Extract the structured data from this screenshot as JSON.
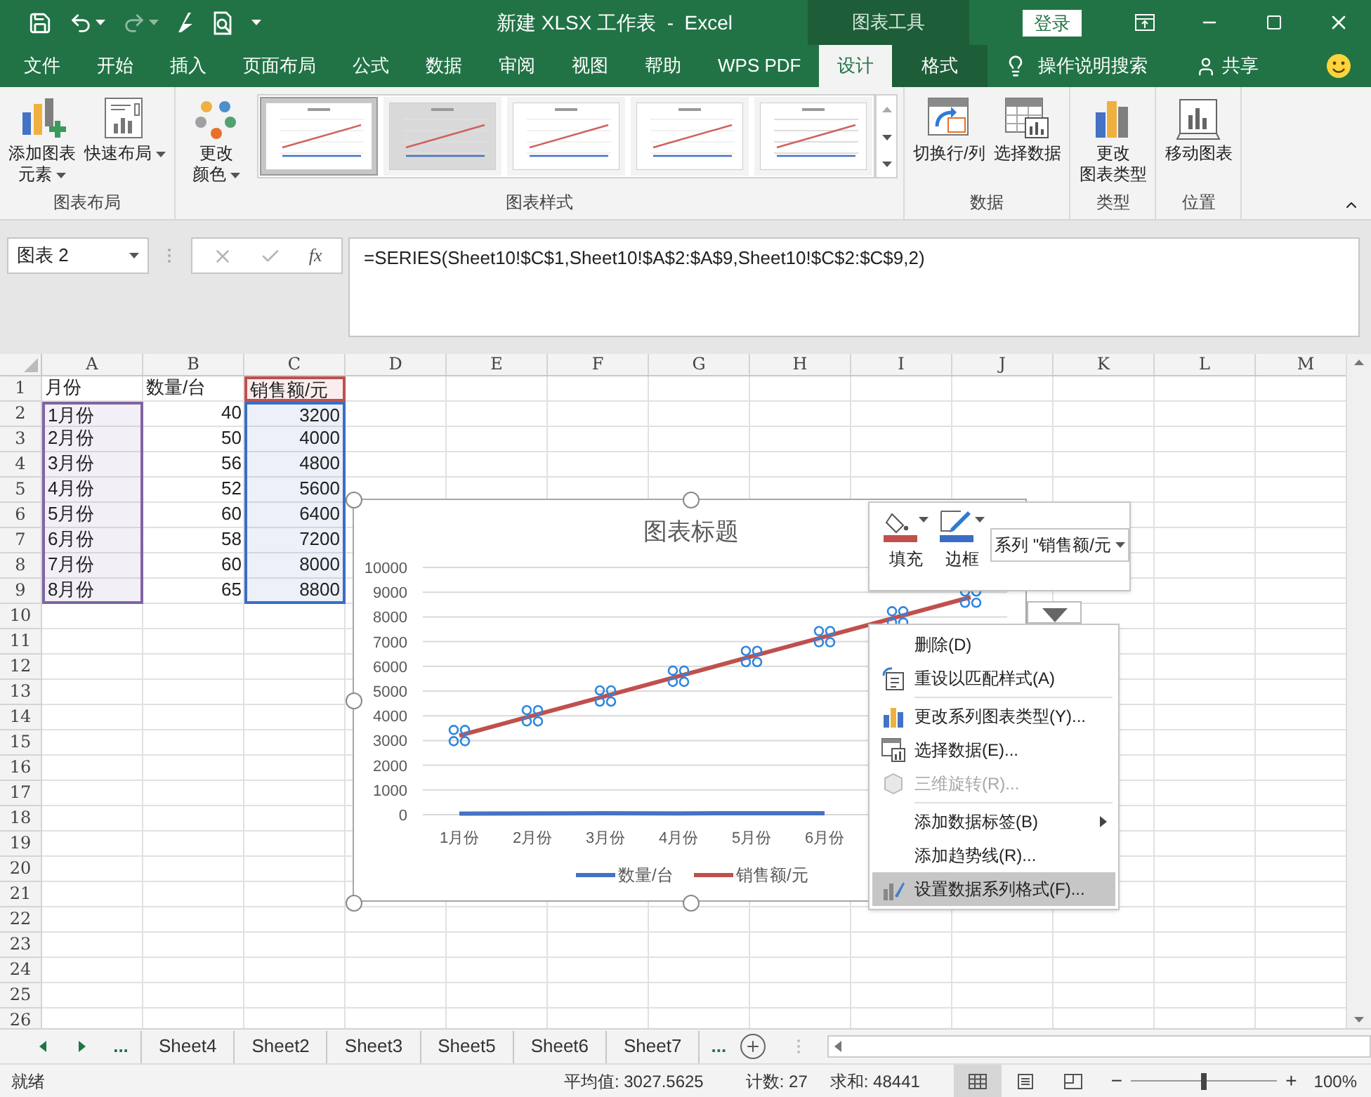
{
  "window": {
    "title": "新建 XLSX 工作表  -  Excel",
    "context_tab_group": "图表工具",
    "sign_in": "登录"
  },
  "tabs": [
    {
      "label": "文件",
      "selected": false
    },
    {
      "label": "开始",
      "selected": false
    },
    {
      "label": "插入",
      "selected": false
    },
    {
      "label": "页面布局",
      "selected": false
    },
    {
      "label": "公式",
      "selected": false
    },
    {
      "label": "数据",
      "selected": false
    },
    {
      "label": "审阅",
      "selected": false
    },
    {
      "label": "视图",
      "selected": false
    },
    {
      "label": "帮助",
      "selected": false
    },
    {
      "label": "WPS PDF",
      "selected": false
    },
    {
      "label": "设计",
      "selected": true
    },
    {
      "label": "格式",
      "selected": false
    }
  ],
  "tell_me": "操作说明搜索",
  "share": "共享",
  "ribbon": {
    "groups": [
      {
        "label": "图表布局",
        "buttons": [
          {
            "lines": [
              "添加图表",
              "元素"
            ],
            "dropdown": true
          },
          {
            "lines": [
              "快速布局"
            ],
            "dropdown": true
          }
        ]
      },
      {
        "label": "图表样式",
        "buttons": [
          {
            "lines": [
              "更改",
              "颜色"
            ],
            "dropdown": true
          }
        ],
        "gallery": [
          {
            "selected": true
          },
          {
            "selected": false
          },
          {
            "selected": false
          },
          {
            "selected": false
          },
          {
            "selected": false
          }
        ]
      },
      {
        "label": "数据",
        "buttons": [
          {
            "lines": [
              "切换行/列"
            ],
            "dropdown": false
          },
          {
            "lines": [
              "选择数据"
            ],
            "dropdown": false
          }
        ]
      },
      {
        "label": "类型",
        "buttons": [
          {
            "lines": [
              "更改",
              "图表类型"
            ],
            "dropdown": false
          }
        ]
      },
      {
        "label": "位置",
        "buttons": [
          {
            "lines": [
              "移动图表"
            ],
            "dropdown": false
          }
        ]
      }
    ]
  },
  "formula_bar": {
    "name_box": "图表 2",
    "fx_label": "fx",
    "formula": "=SERIES(Sheet10!$C$1,Sheet10!$A$2:$A$9,Sheet10!$C$2:$C$9,2)"
  },
  "grid": {
    "columns": [
      "A",
      "B",
      "C",
      "D",
      "E",
      "F",
      "G",
      "H",
      "I",
      "J",
      "K",
      "L",
      "M"
    ],
    "rows": [
      {
        "number": "1",
        "cells": [
          {
            "text": "月份",
            "kind": "text"
          },
          {
            "text": "数量/台",
            "kind": "text"
          },
          {
            "text": "销售额/元",
            "kind": "text",
            "color": "#c0504d"
          }
        ]
      },
      {
        "number": "2",
        "cells": [
          {
            "text": "1月份",
            "kind": "text",
            "color": "#8064a2"
          },
          {
            "text": "40",
            "kind": "number"
          },
          {
            "text": "3200",
            "kind": "number",
            "color": "#3a6ec4"
          }
        ]
      },
      {
        "number": "3",
        "cells": [
          {
            "text": "2月份",
            "kind": "text",
            "color": "#8064a2"
          },
          {
            "text": "50",
            "kind": "number"
          },
          {
            "text": "4000",
            "kind": "number",
            "color": "#3a6ec4"
          }
        ]
      },
      {
        "number": "4",
        "cells": [
          {
            "text": "3月份",
            "kind": "text",
            "color": "#8064a2"
          },
          {
            "text": "56",
            "kind": "number"
          },
          {
            "text": "4800",
            "kind": "number",
            "color": "#3a6ec4"
          }
        ]
      },
      {
        "number": "5",
        "cells": [
          {
            "text": "4月份",
            "kind": "text",
            "color": "#8064a2"
          },
          {
            "text": "52",
            "kind": "number"
          },
          {
            "text": "5600",
            "kind": "number",
            "color": "#3a6ec4"
          }
        ]
      },
      {
        "number": "6",
        "cells": [
          {
            "text": "5月份",
            "kind": "text",
            "color": "#8064a2"
          },
          {
            "text": "60",
            "kind": "number"
          },
          {
            "text": "6400",
            "kind": "number",
            "color": "#3a6ec4"
          }
        ]
      },
      {
        "number": "7",
        "cells": [
          {
            "text": "6月份",
            "kind": "text",
            "color": "#8064a2"
          },
          {
            "text": "58",
            "kind": "number"
          },
          {
            "text": "7200",
            "kind": "number",
            "color": "#3a6ec4"
          }
        ]
      },
      {
        "number": "8",
        "cells": [
          {
            "text": "7月份",
            "kind": "text",
            "color": "#8064a2"
          },
          {
            "text": "60",
            "kind": "number"
          },
          {
            "text": "8000",
            "kind": "number",
            "color": "#3a6ec4"
          }
        ]
      },
      {
        "number": "9",
        "cells": [
          {
            "text": "8月份",
            "kind": "text",
            "color": "#8064a2"
          },
          {
            "text": "65",
            "kind": "number"
          },
          {
            "text": "8800",
            "kind": "number",
            "color": "#3a6ec4"
          }
        ]
      },
      {
        "number": "10",
        "cells": []
      },
      {
        "number": "11",
        "cells": []
      },
      {
        "number": "12",
        "cells": []
      },
      {
        "number": "13",
        "cells": []
      },
      {
        "number": "14",
        "cells": []
      },
      {
        "number": "15",
        "cells": []
      },
      {
        "number": "16",
        "cells": []
      },
      {
        "number": "17",
        "cells": []
      },
      {
        "number": "18",
        "cells": []
      },
      {
        "number": "19",
        "cells": []
      },
      {
        "number": "20",
        "cells": []
      },
      {
        "number": "21",
        "cells": []
      },
      {
        "number": "22",
        "cells": []
      },
      {
        "number": "23",
        "cells": []
      },
      {
        "number": "24",
        "cells": []
      },
      {
        "number": "25",
        "cells": []
      },
      {
        "number": "26",
        "cells": []
      }
    ]
  },
  "chart": {
    "chart_data": {
      "type": "line",
      "title": "图表标题",
      "categories": [
        "1月份",
        "2月份",
        "3月份",
        "4月份",
        "5月份",
        "6月份",
        null,
        null
      ],
      "series": [
        {
          "name": "数量/台",
          "color": "#4472c4",
          "values": [
            40,
            50,
            56,
            52,
            60,
            58,
            null,
            null
          ]
        },
        {
          "name": "销售额/元",
          "color": "#c0504d",
          "values": [
            3200,
            4000,
            4800,
            5600,
            6400,
            7200,
            8000,
            8800
          ]
        }
      ],
      "ylim": [
        0,
        10000
      ],
      "yticks": [
        {
          "value": 0,
          "label": "0"
        },
        {
          "value": 1000,
          "label": "1000"
        },
        {
          "value": 2000,
          "label": "2000"
        },
        {
          "value": 3000,
          "label": "3000"
        },
        {
          "value": 4000,
          "label": "4000"
        },
        {
          "value": 5000,
          "label": "5000"
        },
        {
          "value": 6000,
          "label": "6000"
        },
        {
          "value": 7000,
          "label": "7000"
        },
        {
          "value": 8000,
          "label": "8000"
        },
        {
          "value": 9000,
          "label": "9000"
        },
        {
          "value": 10000,
          "label": "10000"
        }
      ],
      "grid": true,
      "legend": true
    }
  },
  "format_popup": {
    "fill": "填充",
    "outline": "边框",
    "series_picker": "系列 \"销售额/元"
  },
  "context_menu": [
    {
      "label": "删除(D)",
      "disabled": false,
      "selected": false,
      "separator_before": false,
      "submenu": false
    },
    {
      "label": "重设以匹配样式(A)",
      "disabled": false,
      "selected": false,
      "separator_before": false,
      "submenu": false
    },
    {
      "label": "更改系列图表类型(Y)...",
      "disabled": false,
      "selected": false,
      "separator_before": true,
      "submenu": false
    },
    {
      "label": "选择数据(E)...",
      "disabled": false,
      "selected": false,
      "separator_before": false,
      "submenu": false
    },
    {
      "label": "三维旋转(R)...",
      "disabled": true,
      "selected": false,
      "separator_before": false,
      "submenu": false
    },
    {
      "label": "添加数据标签(B)",
      "disabled": false,
      "selected": false,
      "separator_before": true,
      "submenu": true
    },
    {
      "label": "添加趋势线(R)...",
      "disabled": false,
      "selected": false,
      "separator_before": false,
      "submenu": false
    },
    {
      "label": "设置数据系列格式(F)...",
      "disabled": false,
      "selected": true,
      "separator_before": false,
      "submenu": false
    }
  ],
  "sheet_tabs": {
    "more_left": "...",
    "tabs": [
      {
        "label": "Sheet4",
        "selected": false
      },
      {
        "label": "Sheet2",
        "selected": false
      },
      {
        "label": "Sheet3",
        "selected": false
      },
      {
        "label": "Sheet5",
        "selected": false
      },
      {
        "label": "Sheet6",
        "selected": false
      },
      {
        "label": "Sheet7",
        "selected": false
      }
    ],
    "more_right": "..."
  },
  "status_bar": {
    "mode": "就绪",
    "average": "平均值: 3027.5625",
    "count": "计数: 27",
    "sum": "求和: 48441",
    "views": [
      {
        "selected": true
      },
      {
        "selected": false
      },
      {
        "selected": false
      }
    ],
    "zoom": {
      "level": 0.5,
      "reading": "100%",
      "minus": "−",
      "plus": "+"
    }
  }
}
